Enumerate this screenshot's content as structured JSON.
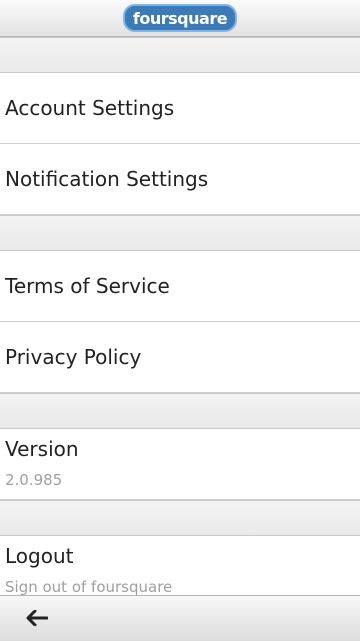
{
  "header": {
    "logo_text_1": "four",
    "logo_text_2": "square"
  },
  "sections": {
    "account_settings": "Account Settings",
    "notification_settings": "Notification Settings",
    "terms_of_service": "Terms of Service",
    "privacy_policy": "Privacy Policy",
    "version_label": "Version",
    "version_value": "2.0.985",
    "logout_label": "Logout",
    "logout_sub": "Sign out of foursquare"
  },
  "footer": {
    "back_icon": "back-arrow-icon"
  }
}
